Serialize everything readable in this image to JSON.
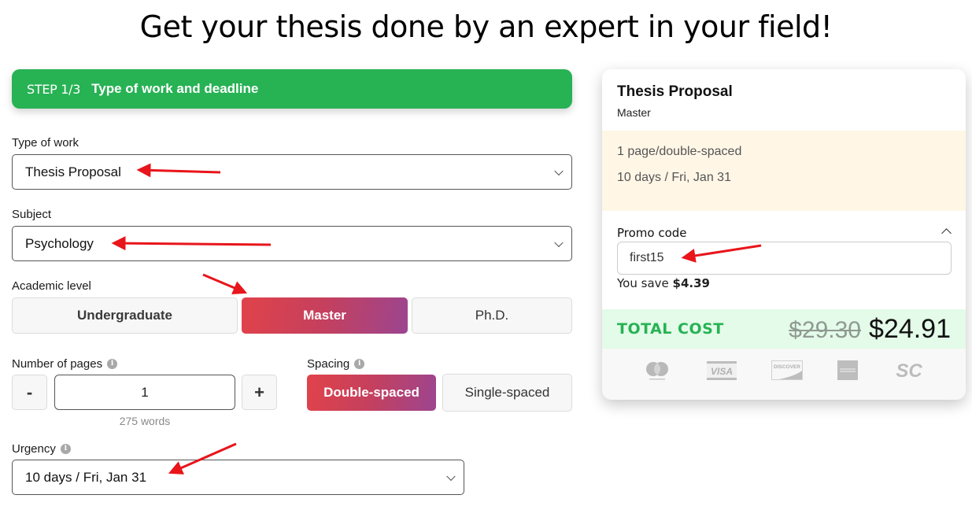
{
  "headline": "Get your thesis done by an expert in your field!",
  "step": {
    "number": "STEP 1/3",
    "title": "Type of work and deadline",
    "color": "#27b254"
  },
  "form": {
    "type_of_work": {
      "label": "Type of work",
      "value": "Thesis Proposal"
    },
    "subject": {
      "label": "Subject",
      "value": "Psychology"
    },
    "academic_level": {
      "label": "Academic level",
      "options": [
        "Undergraduate",
        "Master",
        "Ph.D."
      ],
      "selected": "Master"
    },
    "pages": {
      "label": "Number of pages",
      "info_icon": "info-icon",
      "minus_label": "-",
      "plus_label": "+",
      "value": "1",
      "words_note": "275 words"
    },
    "spacing": {
      "label": "Spacing",
      "info_icon": "info-icon",
      "options": [
        "Double-spaced",
        "Single-spaced"
      ],
      "selected": "Double-spaced"
    },
    "urgency": {
      "label": "Urgency",
      "info_icon": "info-icon",
      "value": "10 days / Fri, Jan 31"
    }
  },
  "summary": {
    "title": "Thesis Proposal",
    "level": "Master",
    "details": [
      "1 page/double-spaced",
      "10 days / Fri, Jan 31"
    ],
    "promo": {
      "label": "Promo code",
      "value": "first15",
      "save_prefix": "You save",
      "save_amount": "$4.39"
    },
    "total": {
      "label": "TOTAL COST",
      "old_price": "$29.30",
      "new_price": "$24.91",
      "label_color": "#27b254"
    },
    "payment_methods": [
      "mastercard-icon",
      "visa-icon",
      "discover-icon",
      "amex-icon",
      "sc-icon"
    ]
  },
  "annotations": {
    "arrow_color": "#e8151b"
  }
}
